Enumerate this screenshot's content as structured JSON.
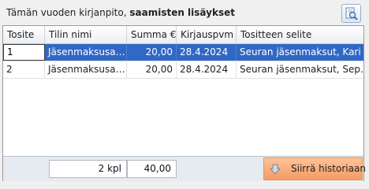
{
  "header": {
    "title_prefix": "Tämän vuoden kirjanpito, ",
    "title_bold": "saamisten lisäykset"
  },
  "toolbar": {
    "preview_icon": "magnifier-document-icon"
  },
  "table": {
    "columns": [
      "Tosite",
      "Tilin nimi",
      "Summa €",
      "Kirjauspvm",
      "Tositteen selite"
    ],
    "rows": [
      {
        "tosite": "1",
        "tilin_nimi": "Jäsenmaksusa…",
        "summa": "20,00",
        "kirjauspvm": "28.4.2024",
        "selite": "Seuran jäsenmaksut, Kari …",
        "selected": true
      },
      {
        "tosite": "2",
        "tilin_nimi": "Jäsenmaksusa…",
        "summa": "20,00",
        "kirjauspvm": "28.4.2024",
        "selite": "Seuran jäsenmaksut, Sep…",
        "selected": false
      }
    ]
  },
  "footer": {
    "count": "2 kpl",
    "total": "40,00",
    "move_button_label": "Siirrä historiaan",
    "move_button_icon": "arrow-down-icon"
  },
  "colors": {
    "selection": "#3168c6",
    "move_button": "#f6a26a"
  }
}
